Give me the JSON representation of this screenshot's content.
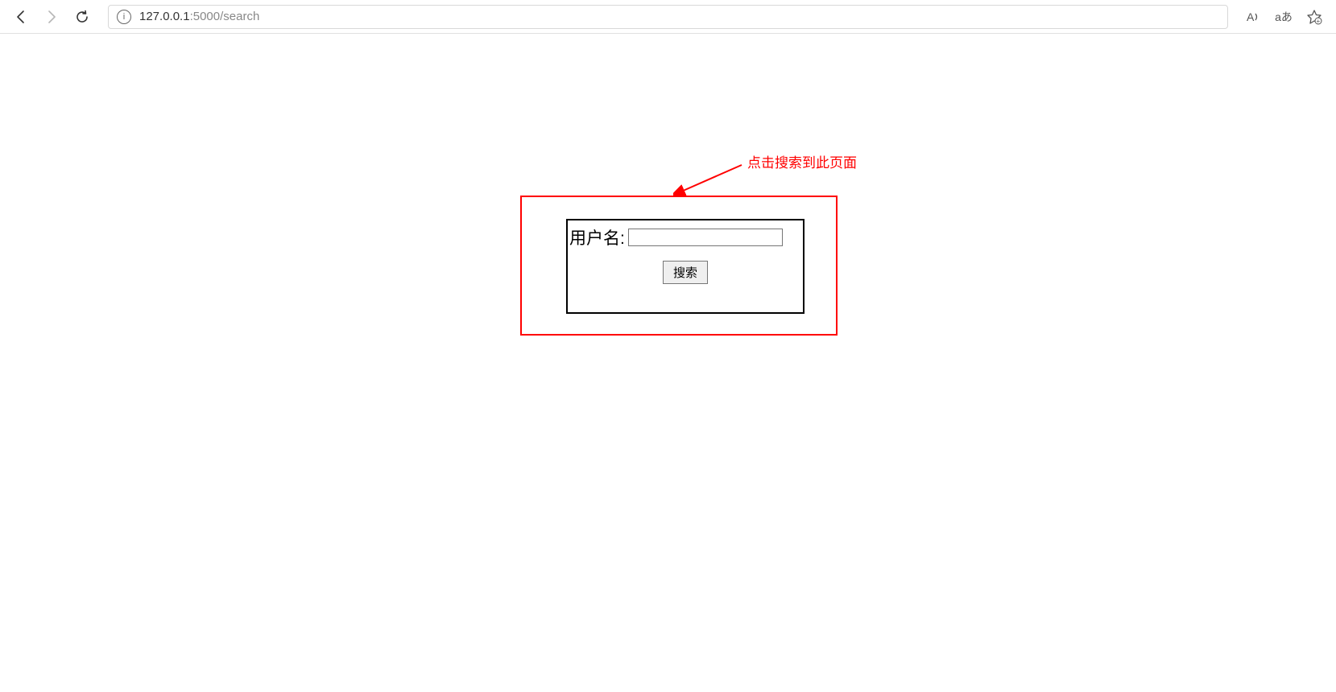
{
  "browser": {
    "url_host": "127.0.0.1",
    "url_port_path": ":5000/search"
  },
  "annotation": {
    "text": "点击搜索到此页面"
  },
  "form": {
    "username_label": "用户名:",
    "username_value": "",
    "search_button_label": "搜索"
  }
}
